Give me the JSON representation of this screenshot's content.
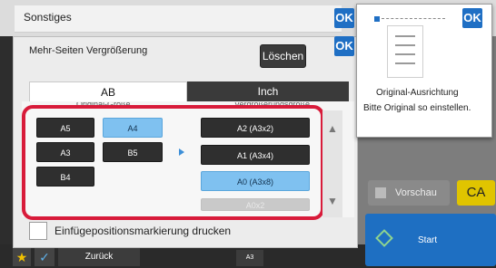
{
  "top_bar": {
    "title": "Sonstiges",
    "ok_label": "OK"
  },
  "dialog": {
    "title": "Mehr-Seiten Vergrößerung",
    "ok_label": "OK",
    "clear_label": "Löschen",
    "tabs": [
      {
        "label": "AB",
        "selected": true
      },
      {
        "label": "Inch",
        "selected": false
      }
    ],
    "original_size_header": "Original-Größe",
    "enlargement_header": "Vergrößerungsgröße",
    "original_sizes": [
      {
        "label": "A5",
        "selected": false
      },
      {
        "label": "A4",
        "selected": true
      },
      {
        "label": "A3",
        "selected": false
      },
      {
        "label": "B5",
        "selected": false
      },
      {
        "label": "B4",
        "selected": false
      }
    ],
    "enlargement_sizes": [
      {
        "label": "A2 (A3x2)",
        "selected": false,
        "disabled": false
      },
      {
        "label": "A1 (A3x4)",
        "selected": false,
        "disabled": false
      },
      {
        "label": "A0 (A3x8)",
        "selected": true,
        "disabled": false
      },
      {
        "label": "A0x2",
        "selected": false,
        "disabled": true
      }
    ],
    "print_mark_label": "Einfügepositionsmarkierung drucken"
  },
  "orientation_panel": {
    "ok_label": "OK",
    "title": "Original-Ausrichtung",
    "message": "Bitte Original so einstellen."
  },
  "right_panel": {
    "preview_label": "Vorschau",
    "ca_label": "CA",
    "start_label": "Start"
  },
  "bottom_bar": {
    "back_label": "Zurück",
    "paper_label": "A3"
  },
  "colors": {
    "accent": "#1f6fc4",
    "highlight": "#d81b3a",
    "selected": "#7fc1f0",
    "ca": "#e0c400"
  }
}
